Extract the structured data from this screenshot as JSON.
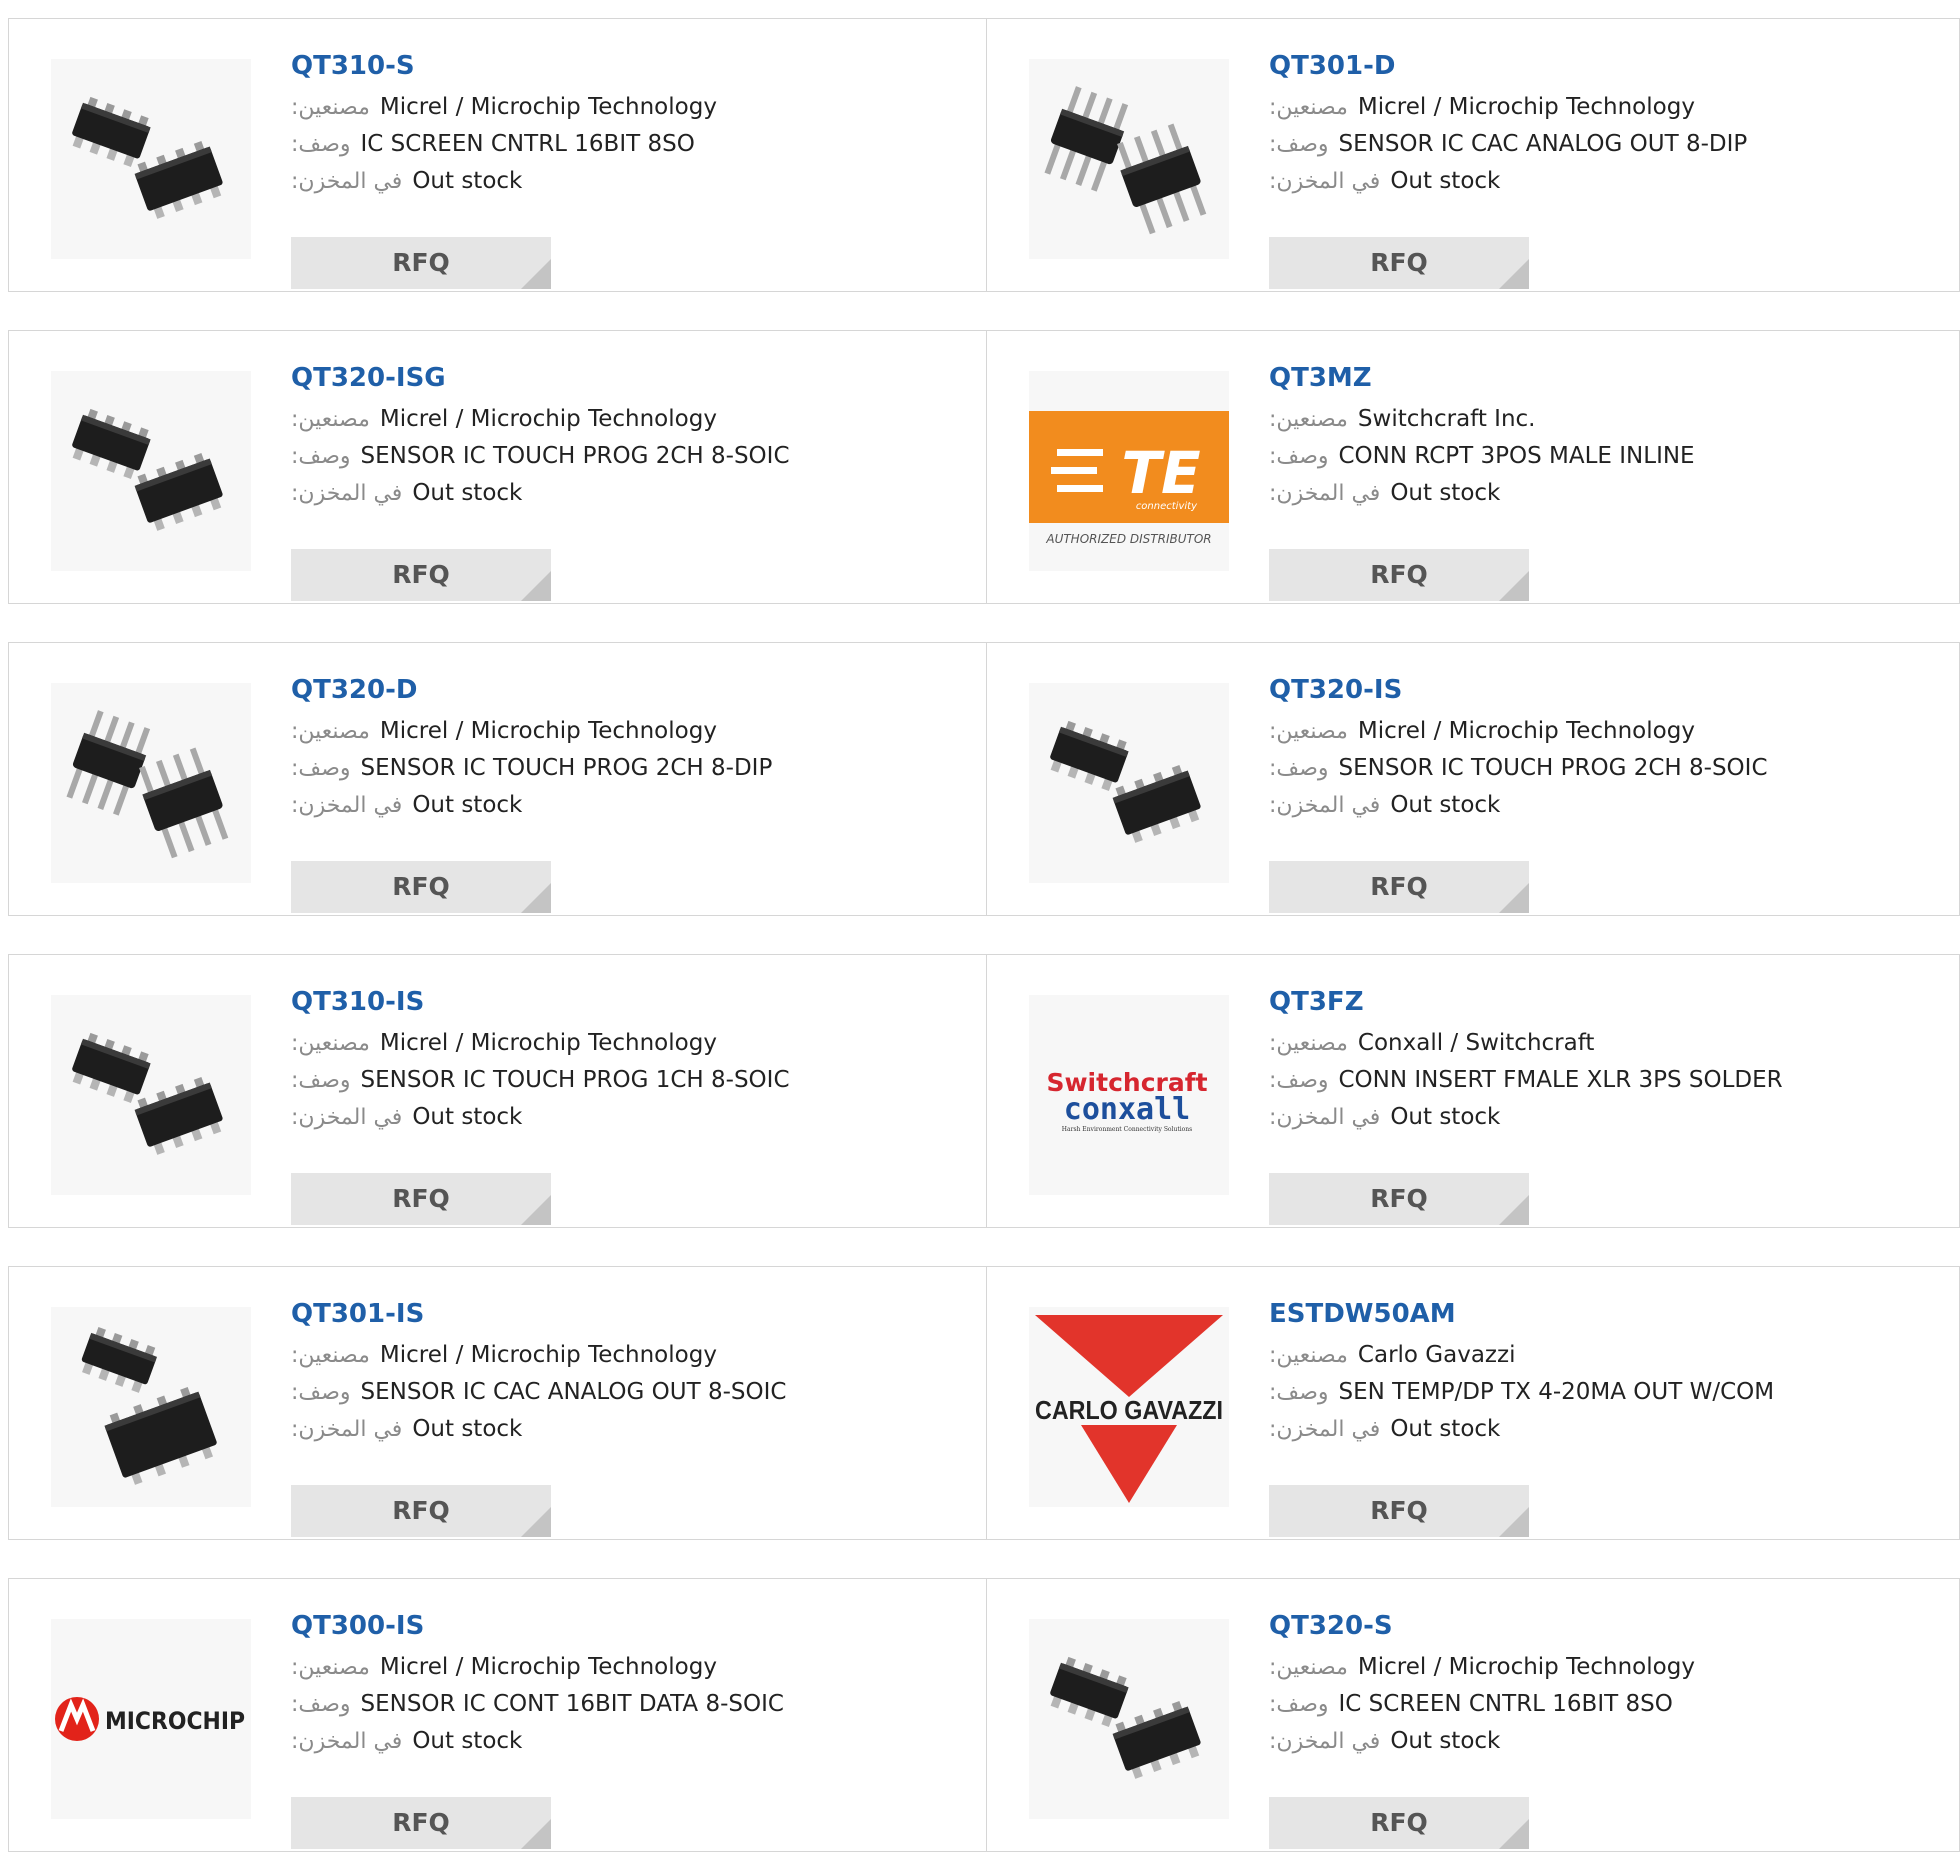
{
  "labels": {
    "manufacturer": ":مصنعين",
    "description": ":وصف",
    "stock": ":في المخزن"
  },
  "products": [
    {
      "part": "QT310-S",
      "manufacturer": "Micrel / Microchip Technology",
      "description": "IC SCREEN CNTRL 16BIT 8SO",
      "stock": "Out stock",
      "rfq": "RFQ",
      "image": "soic-chip-icon"
    },
    {
      "part": "QT301-D",
      "manufacturer": "Micrel / Microchip Technology",
      "description": "SENSOR IC CAC ANALOG OUT 8-DIP",
      "stock": "Out stock",
      "rfq": "RFQ",
      "image": "dip-chip-icon"
    },
    {
      "part": "QT320-ISG",
      "manufacturer": "Micrel / Microchip Technology",
      "description": "SENSOR IC TOUCH PROG 2CH 8-SOIC",
      "stock": "Out stock",
      "rfq": "RFQ",
      "image": "soic-chip-icon"
    },
    {
      "part": "QT3MZ",
      "manufacturer": "Switchcraft Inc.",
      "description": "CONN RCPT 3POS MALE INLINE",
      "stock": "Out stock",
      "rfq": "RFQ",
      "image": "te-logo",
      "logo": {
        "text1": "TE",
        "text2": "connectivity",
        "text3": "AUTHORIZED DISTRIBUTOR",
        "color": "#f28c1e"
      }
    },
    {
      "part": "QT320-D",
      "manufacturer": "Micrel / Microchip Technology",
      "description": "SENSOR IC TOUCH PROG 2CH 8-DIP",
      "stock": "Out stock",
      "rfq": "RFQ",
      "image": "dip-chip-icon"
    },
    {
      "part": "QT320-IS",
      "manufacturer": "Micrel / Microchip Technology",
      "description": "SENSOR IC TOUCH PROG 2CH 8-SOIC",
      "stock": "Out stock",
      "rfq": "RFQ",
      "image": "soic-chip-icon"
    },
    {
      "part": "QT310-IS",
      "manufacturer": "Micrel / Microchip Technology",
      "description": "SENSOR IC TOUCH PROG 1CH 8-SOIC",
      "stock": "Out stock",
      "rfq": "RFQ",
      "image": "soic-chip-icon"
    },
    {
      "part": "QT3FZ",
      "manufacturer": "Conxall / Switchcraft",
      "description": "CONN INSERT FMALE XLR 3PS SOLDER",
      "stock": "Out stock",
      "rfq": "RFQ",
      "image": "switchcraft-logo",
      "logo": {
        "text1": "Switchcraft",
        "text2": "conxall",
        "text3": "Harsh Environment Connectivity Solutions",
        "color": "#d6262f",
        "color2": "#1d4f9c"
      }
    },
    {
      "part": "QT301-IS",
      "manufacturer": "Micrel / Microchip Technology",
      "description": "SENSOR IC CAC ANALOG OUT 8-SOIC",
      "stock": "Out stock",
      "rfq": "RFQ",
      "image": "soic-chip-large-icon"
    },
    {
      "part": "ESTDW50AM",
      "manufacturer": "Carlo Gavazzi",
      "description": "SEN TEMP/DP TX 4-20MA OUT W/COM",
      "stock": "Out stock",
      "rfq": "RFQ",
      "image": "carlo-gavazzi-logo",
      "logo": {
        "text1": "CARLO GAVAZZI",
        "color": "#e2342b"
      }
    },
    {
      "part": "QT300-IS",
      "manufacturer": "Micrel / Microchip Technology",
      "description": "SENSOR IC CONT 16BIT DATA 8-SOIC",
      "stock": "Out stock",
      "rfq": "RFQ",
      "image": "microchip-logo",
      "logo": {
        "text1": "MICROCHIP",
        "color": "#e2231a"
      }
    },
    {
      "part": "QT320-S",
      "manufacturer": "Micrel / Microchip Technology",
      "description": "IC SCREEN CNTRL 16BIT 8SO",
      "stock": "Out stock",
      "rfq": "RFQ",
      "image": "soic-chip-icon"
    }
  ]
}
